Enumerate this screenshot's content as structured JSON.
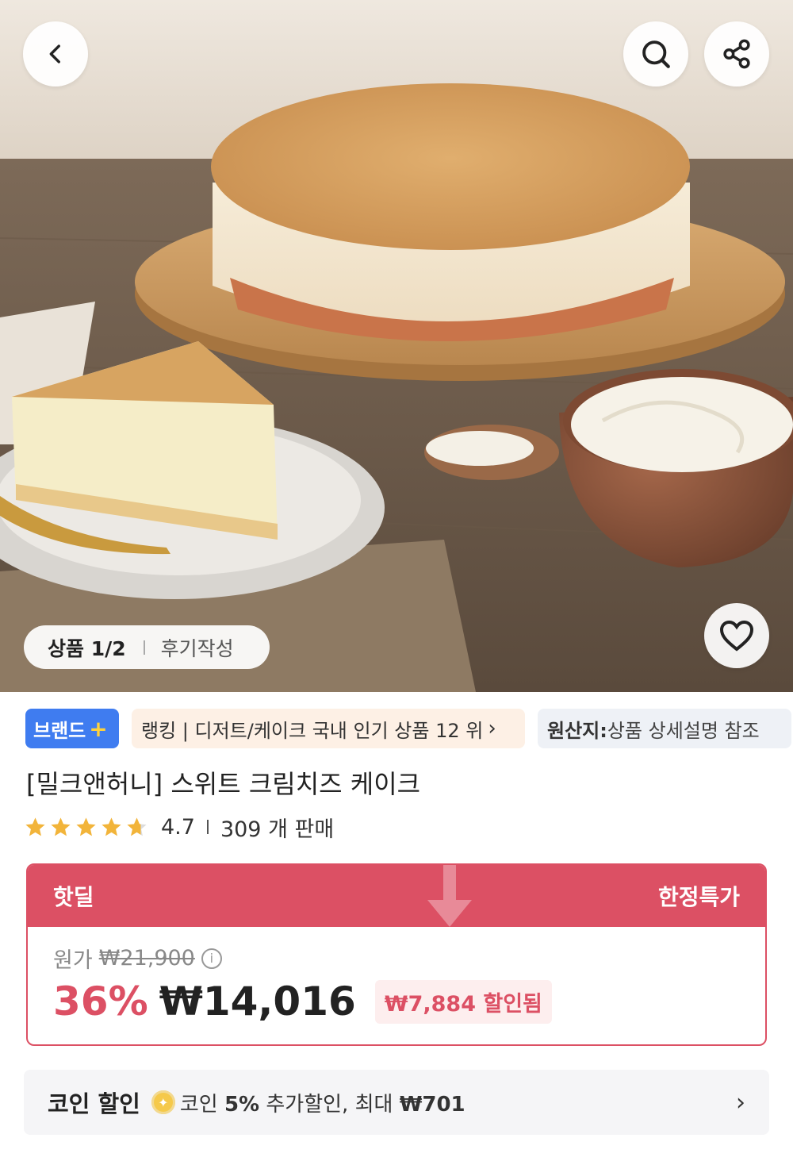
{
  "hero": {
    "image_counter": "상품 1/2",
    "review_link": "후기작성",
    "icons": {
      "back": "chevron-left-icon",
      "search": "search-icon",
      "share": "share-icon",
      "wish": "heart-icon"
    }
  },
  "tags": {
    "brand": "브랜드",
    "brand_plus": "+",
    "ranking": "랭킹 | 디저트/케이크 국내 인기 상품 12 위",
    "origin_label": "원산지:",
    "origin_value": " 상품 상세설명 참조"
  },
  "product": {
    "title": "[밀크앤허니] 스위트 크림치즈 케이크",
    "rating": "4.7",
    "rating_stars": 4.7,
    "sold": "309 개 판매"
  },
  "deal": {
    "label": "핫딜",
    "badge": "한정특가",
    "original_label": "원가",
    "original_price": "₩21,900",
    "discount_rate": "36%",
    "sale_price": "₩14,016",
    "saved": "₩7,884 할인됨"
  },
  "coin": {
    "label": "코인 할인",
    "text_prefix": "코인 ",
    "percent": "5%",
    "text_mid": " 추가할인, 최대 ",
    "max": "₩701"
  },
  "colors": {
    "brand_blue": "#3f7cf0",
    "deal_red": "#dc5064",
    "star_gold": "#f2b43a"
  }
}
